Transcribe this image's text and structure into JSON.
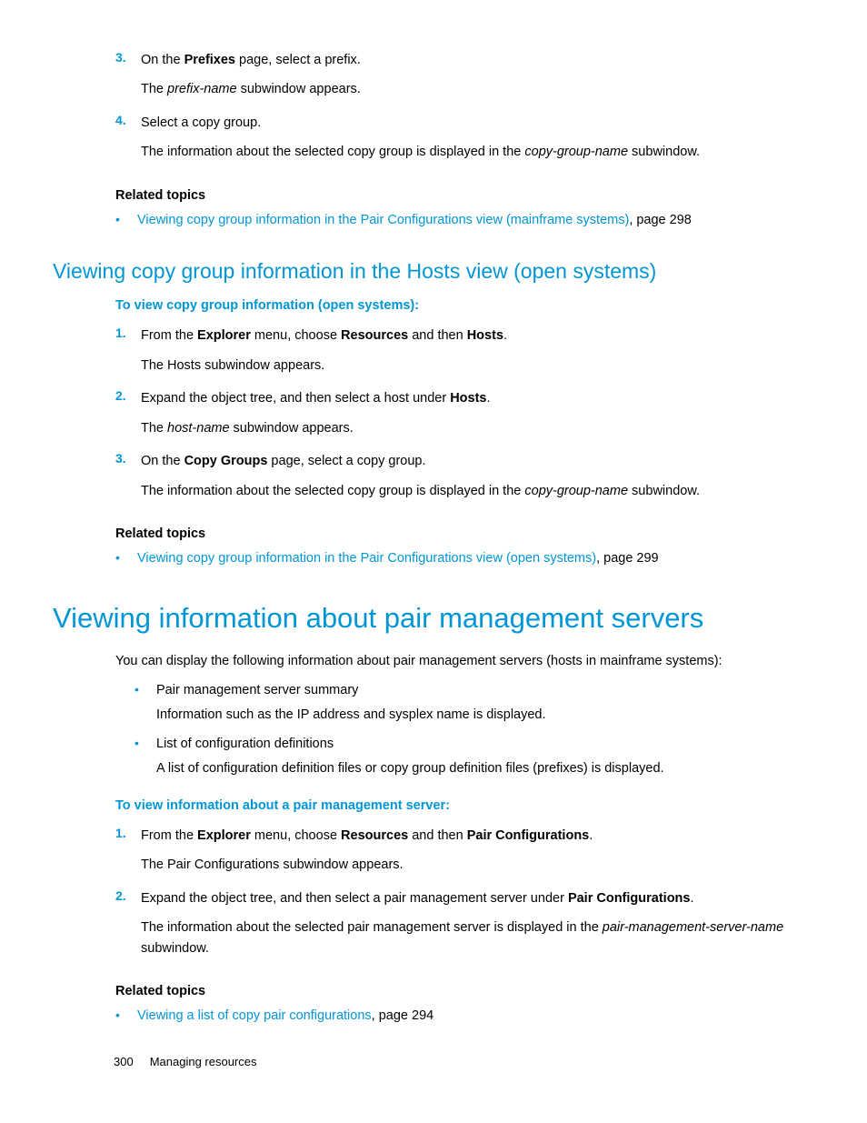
{
  "top_steps": [
    {
      "num": "3.",
      "line1_pre": "On the ",
      "line1_bold": "Prefixes",
      "line1_post": " page, select a prefix.",
      "line2_pre": "The ",
      "line2_italic": "prefix-name",
      "line2_post": " subwindow appears."
    },
    {
      "num": "4.",
      "line1": "Select a copy group.",
      "line2_pre": "The information about the selected copy group is displayed in the ",
      "line2_italic": "copy-group-name",
      "line2_post": " subwindow."
    }
  ],
  "related1": {
    "heading": "Related topics",
    "link": "Viewing copy group information in the Pair Configurations view (mainframe systems)",
    "page_ref": ", page 298"
  },
  "h2": "Viewing copy group information in the Hosts view (open systems)",
  "lead1": "To view copy group information (open systems):",
  "mid_steps": {
    "s1": {
      "num": "1.",
      "pre": "From the ",
      "b1": "Explorer",
      "mid1": " menu, choose ",
      "b2": "Resources",
      "mid2": " and then ",
      "b3": "Hosts",
      "post": ".",
      "sub": "The Hosts subwindow appears."
    },
    "s2": {
      "num": "2.",
      "pre": "Expand the object tree, and then select a host under ",
      "b1": "Hosts",
      "post": ".",
      "sub_pre": "The ",
      "sub_italic": "host-name",
      "sub_post": " subwindow appears."
    },
    "s3": {
      "num": "3.",
      "pre": "On the ",
      "b1": "Copy Groups",
      "post": " page, select a copy group.",
      "sub_pre": "The information about the selected copy group is displayed in the ",
      "sub_italic": "copy-group-name",
      "sub_post": " subwindow."
    }
  },
  "related2": {
    "heading": "Related topics",
    "link": "Viewing copy group information in the Pair Configurations view (open systems)",
    "page_ref": ", page 299"
  },
  "h1": "Viewing information about pair management servers",
  "para1": "You can display the following information about pair management servers (hosts in mainframe systems):",
  "info_bullets": [
    {
      "line1": "Pair management server summary",
      "line2": "Information such as the IP address and sysplex name is displayed."
    },
    {
      "line1": "List of configuration definitions",
      "line2": "A list of configuration definition files or copy group definition files (prefixes) is displayed."
    }
  ],
  "lead2": "To view information about a pair management server:",
  "bottom_steps": {
    "s1": {
      "num": "1.",
      "pre": "From the ",
      "b1": "Explorer",
      "mid1": " menu, choose ",
      "b2": "Resources",
      "mid2": " and then ",
      "b3": "Pair Configurations",
      "post": ".",
      "sub": "The Pair Configurations subwindow appears."
    },
    "s2": {
      "num": "2.",
      "pre": "Expand the object tree, and then select a pair management server under ",
      "b1": "Pair Configurations",
      "post": ".",
      "sub_pre": "The information about the selected pair management server is displayed in the ",
      "sub_italic": "pair-management-server-name",
      "sub_post": " subwindow."
    }
  },
  "related3": {
    "heading": "Related topics",
    "link": "Viewing a list of copy pair configurations",
    "page_ref": ", page 294"
  },
  "footer": {
    "page": "300",
    "title": "Managing resources"
  }
}
